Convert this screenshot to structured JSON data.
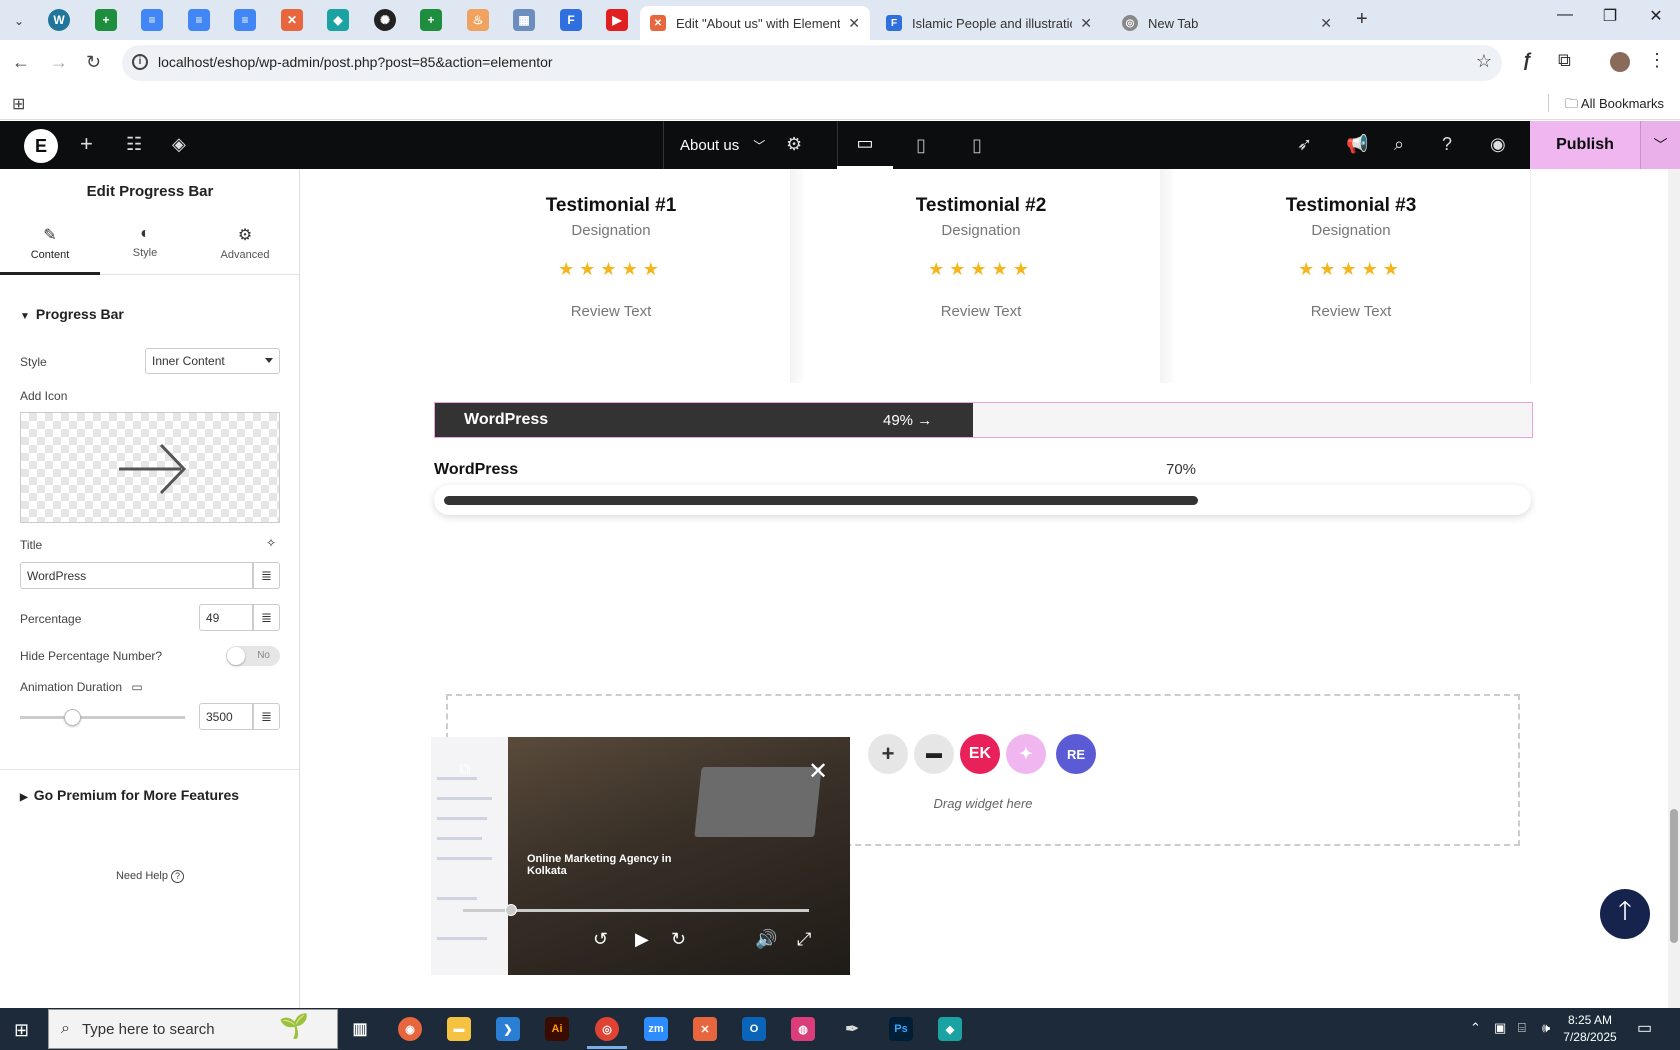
{
  "browser": {
    "tabs": [
      {
        "title": "Edit \"About us\" with Elementor",
        "active": true,
        "close": "✕"
      },
      {
        "title": "Islamic People and illustration v",
        "active": false,
        "close": "✕"
      },
      {
        "title": "New Tab",
        "active": false,
        "close": "✕"
      }
    ],
    "url": "localhost/eshop/wp-admin/post.php?post=85&action=elementor",
    "all_bookmarks": "All Bookmarks"
  },
  "editor": {
    "page_name": "About us",
    "publish_label": "Publish"
  },
  "panel": {
    "title": "Edit Progress Bar",
    "tabs": {
      "content": "Content",
      "style": "Style",
      "advanced": "Advanced"
    },
    "section_progress": "Progress Bar",
    "style_label": "Style",
    "style_value": "Inner Content",
    "add_icon_label": "Add Icon",
    "title_label": "Title",
    "title_value": "WordPress",
    "percentage_label": "Percentage",
    "percentage_value": "49",
    "hide_percentage_label": "Hide Percentage Number?",
    "hide_percentage_toggle": "No",
    "animation_label": "Animation Duration",
    "animation_value": "3500",
    "animation_fraction": 0.3,
    "section_premium": "Go Premium for More Features",
    "need_help": "Need Help"
  },
  "canvas": {
    "testimonials": [
      {
        "name": "Testimonial #1",
        "designation": "Designation",
        "stars": "★★★★★",
        "review": "Review Text"
      },
      {
        "name": "Testimonial #2",
        "designation": "Designation",
        "stars": "★★★★★",
        "review": "Review Text"
      },
      {
        "name": "Testimonial #3",
        "designation": "Designation",
        "stars": "★★★★★",
        "review": "Review Text"
      }
    ],
    "progress_inner": {
      "title": "WordPress",
      "percent_text": "49% →",
      "fraction": 0.49
    },
    "progress_outer": {
      "title": "WordPress",
      "percent_text": "70%",
      "fraction": 0.7
    },
    "drag_widget_text": "Drag widget here"
  },
  "video": {
    "headline": "Online Marketing Agency in Kolkata",
    "progress_fraction": 0.12
  },
  "taskbar": {
    "search_placeholder": "Type here to search",
    "time": "8:25 AM",
    "date": "7/28/2025"
  },
  "colors": {
    "publish_bg": "#f0b6f0",
    "star": "#f5b51c",
    "progress_dark": "#333333",
    "elementor_bar": "#0c0d0e"
  }
}
